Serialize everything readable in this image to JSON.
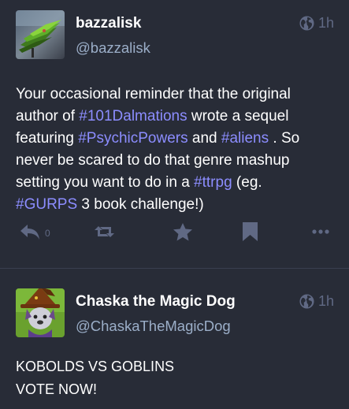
{
  "statuses": [
    {
      "display_name": "bazzalisk",
      "acct": "@bazzalisk",
      "time": "1h",
      "content": [
        {
          "text": "Your occasional reminder that the original\nauthor of ",
          "tag": false
        },
        {
          "text": "#101Dalmations",
          "tag": true
        },
        {
          "text": " wrote a sequel\nfeaturing ",
          "tag": false
        },
        {
          "text": "#PsychicPowers",
          "tag": true
        },
        {
          "text": " and ",
          "tag": false
        },
        {
          "text": "#aliens",
          "tag": true
        },
        {
          "text": " . So\nnever be scared to do that genre mashup\nsetting you want to do in a ",
          "tag": false
        },
        {
          "text": "#ttrpg",
          "tag": true
        },
        {
          "text": " (eg.\n",
          "tag": false
        },
        {
          "text": "#GURPS",
          "tag": true
        },
        {
          "text": " 3 book challenge!)",
          "tag": false
        }
      ],
      "reply_count": "0",
      "icons": {
        "reply": "reply-icon",
        "boost": "boost-icon",
        "favourite": "star-icon",
        "bookmark": "bookmark-icon",
        "more": "ellipsis-icon",
        "visibility": "globe-icon"
      }
    },
    {
      "display_name": "Chaska the Magic Dog",
      "acct": "@ChaskaTheMagicDog",
      "time": "1h",
      "content": [
        {
          "text": "KOBOLDS VS GOBLINS\nVOTE NOW!",
          "tag": false
        }
      ]
    }
  ],
  "colors": {
    "background": "#282c37",
    "text": "#ffffff",
    "secondary_text": "#9baec8",
    "muted": "#606984",
    "hashtag": "#8c8dff",
    "divider": "#393f4f"
  }
}
